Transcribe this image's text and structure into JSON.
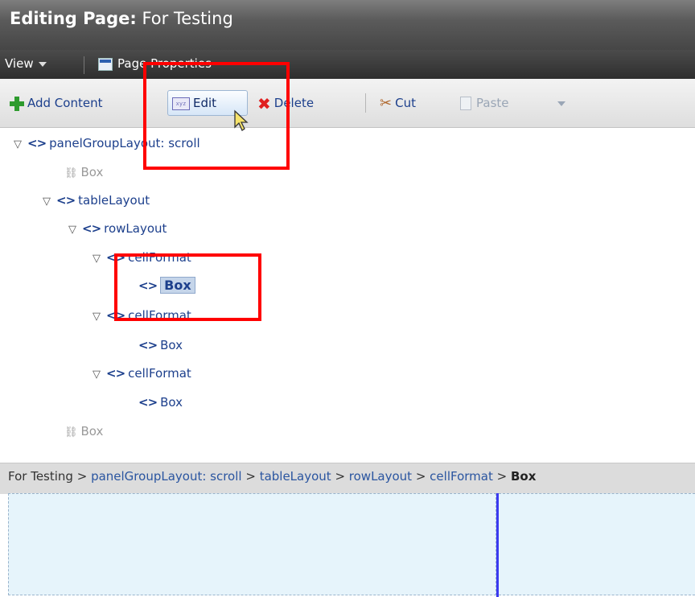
{
  "header": {
    "title_prefix": "Editing Page:",
    "title_name": " For Testing"
  },
  "menubar": {
    "view_label": "View",
    "page_properties_label": "Page Properties"
  },
  "toolbar": {
    "add_content_label": "Add Content",
    "edit_label": "Edit",
    "delete_label": "Delete",
    "cut_label": "Cut",
    "paste_label": "Paste"
  },
  "tree": [
    {
      "label": "panelGroupLayout: scroll",
      "expanded": true,
      "icon": "tag-icon"
    },
    {
      "label": "Box",
      "icon": "broken-link-icon",
      "disabled": true
    },
    {
      "label": "tableLayout",
      "expanded": true,
      "icon": "tag-icon"
    },
    {
      "label": "rowLayout",
      "expanded": true,
      "icon": "tag-icon"
    },
    {
      "label": "cellFormat",
      "expanded": true,
      "icon": "tag-icon"
    },
    {
      "label": "Box",
      "icon": "tag-icon",
      "selected": true
    },
    {
      "label": "cellFormat",
      "expanded": true,
      "icon": "tag-icon"
    },
    {
      "label": "Box",
      "icon": "tag-icon"
    },
    {
      "label": "cellFormat",
      "expanded": true,
      "icon": "tag-icon"
    },
    {
      "label": "Box",
      "icon": "tag-icon"
    },
    {
      "label": "Box",
      "icon": "broken-link-icon",
      "disabled": true
    }
  ],
  "breadcrumb": {
    "items": [
      "For Testing",
      "panelGroupLayout: scroll",
      "tableLayout",
      "rowLayout",
      "cellFormat"
    ],
    "separator": " > ",
    "current": "Box"
  },
  "colors": {
    "highlight": "#ff0000",
    "link": "#1c3f8c",
    "canvas": "#e6f4fb",
    "divider": "#3a3af0"
  }
}
